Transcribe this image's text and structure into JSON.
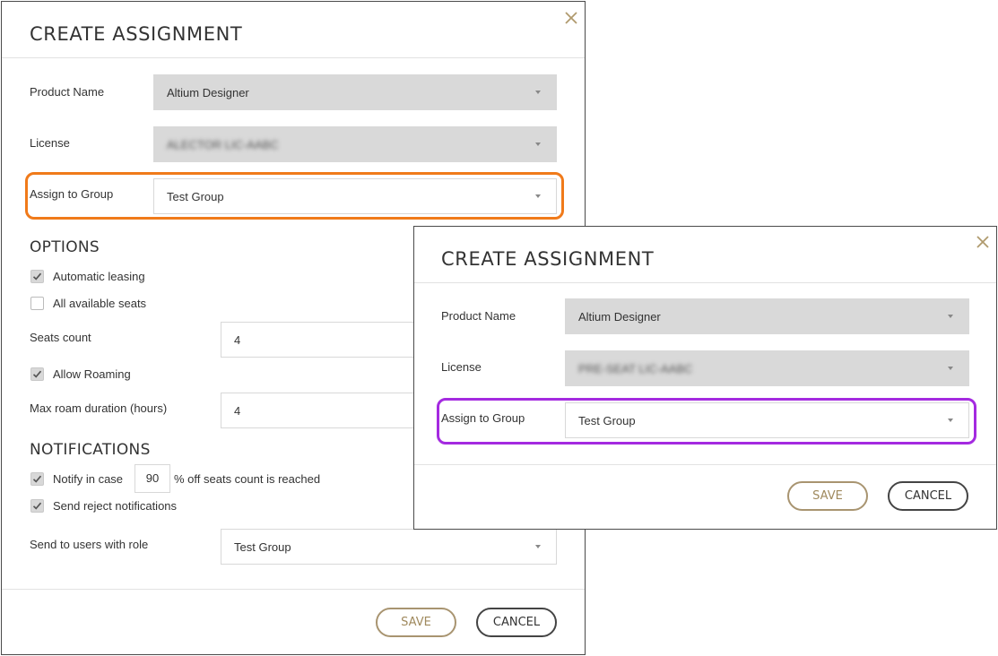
{
  "dialog_main": {
    "title": "CREATE ASSIGNMENT",
    "product_name_label": "Product Name",
    "product_name_value": "Altium Designer",
    "license_label": "License",
    "license_value": "ALECTOR LIC-AABC",
    "assign_group_label": "Assign to Group",
    "assign_group_value": "Test Group",
    "options_title": "OPTIONS",
    "automatic_leasing_label": "Automatic leasing",
    "all_seats_label": "All available seats",
    "seats_count_label": "Seats count",
    "seats_count_value": "4",
    "allow_roaming_label": "Allow Roaming",
    "max_roam_label": "Max roam duration (hours)",
    "max_roam_value": "4",
    "notifications_title": "NOTIFICATIONS",
    "notify_prefix": "Notify in case",
    "notify_value": "90",
    "notify_suffix": "% off seats count is reached",
    "send_reject_label": "Send reject notifications",
    "send_role_label": "Send to users with role",
    "send_role_value": "Test Group",
    "save_label": "SAVE",
    "cancel_label": "CANCEL"
  },
  "dialog_overlay": {
    "title": "CREATE ASSIGNMENT",
    "product_name_label": "Product Name",
    "product_name_value": "Altium Designer",
    "license_label": "License",
    "license_value": "PRE-SEAT LIC-AABC",
    "assign_group_label": "Assign to Group",
    "assign_group_value": "Test Group",
    "save_label": "SAVE",
    "cancel_label": "CANCEL"
  },
  "colors": {
    "orange_highlight": "#f07a1a",
    "purple_highlight": "#a42ae0",
    "save_accent": "#a89470",
    "close_icon": "#b09a6e",
    "disabled_field": "#d9d9d9"
  }
}
